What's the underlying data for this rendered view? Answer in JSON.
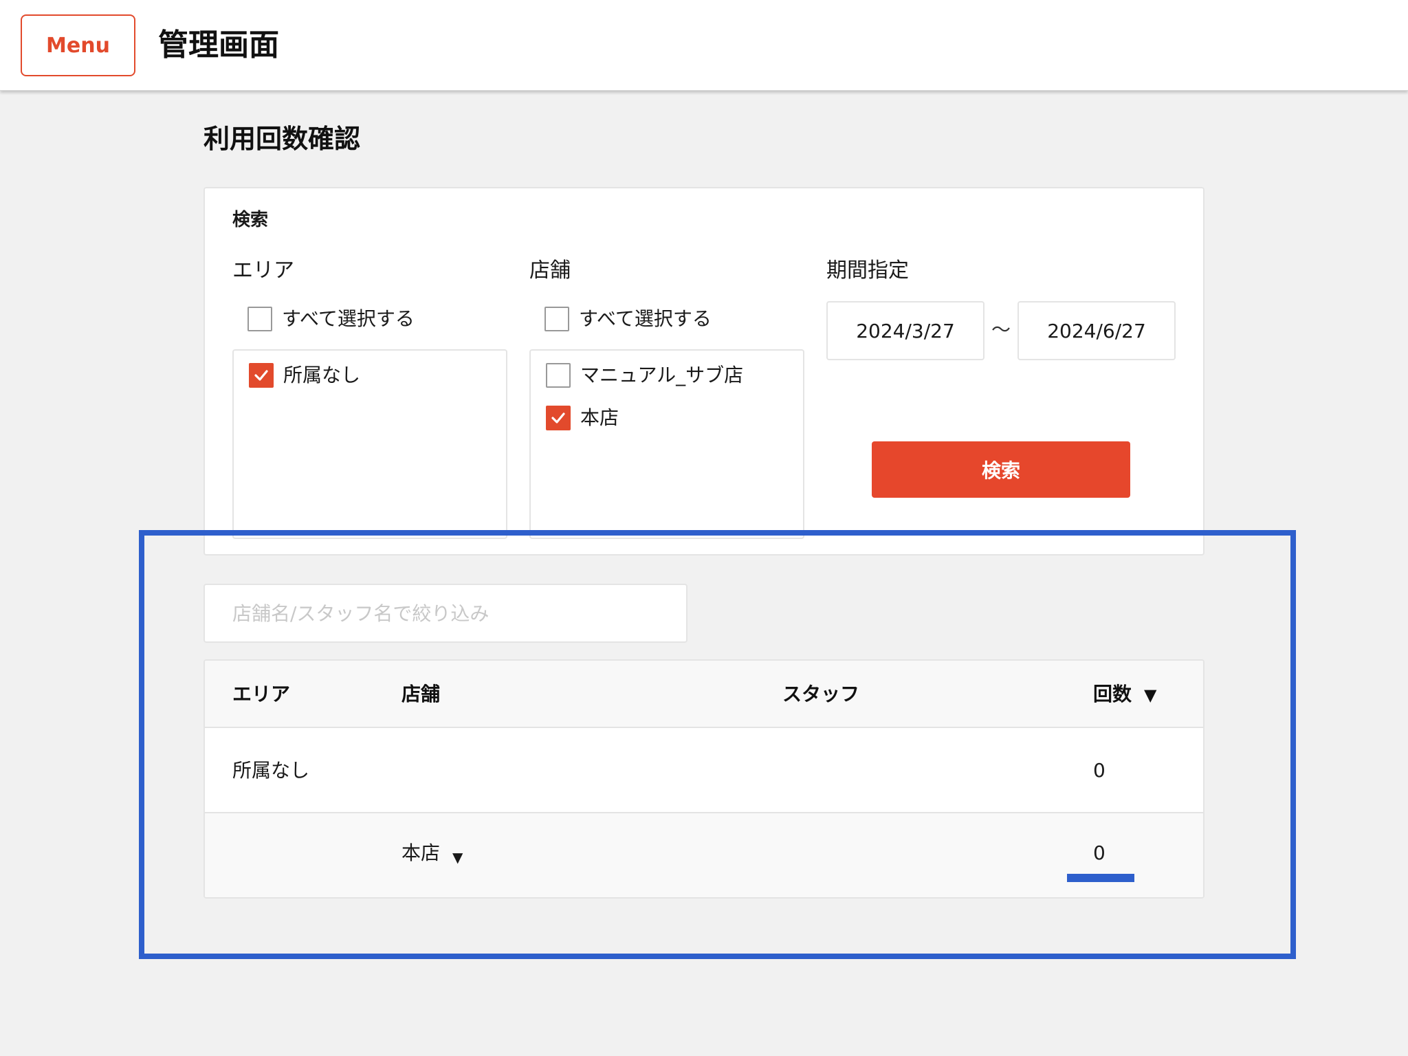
{
  "header": {
    "menu_label": "Menu",
    "app_title": "管理画面"
  },
  "page": {
    "title": "利用回数確認"
  },
  "search": {
    "heading": "検索",
    "area": {
      "label": "エリア",
      "select_all": {
        "label": "すべて選択する",
        "checked": false
      },
      "options": [
        {
          "label": "所属なし",
          "checked": true
        }
      ]
    },
    "store": {
      "label": "店舗",
      "select_all": {
        "label": "すべて選択する",
        "checked": false
      },
      "options": [
        {
          "label": "マニュアル_サブ店",
          "checked": false
        },
        {
          "label": "本店",
          "checked": true
        }
      ]
    },
    "period": {
      "label": "期間指定",
      "from": "2024/3/27",
      "separator": "〜",
      "to": "2024/6/27"
    },
    "button_label": "検索"
  },
  "filter": {
    "placeholder": "店舗名/スタッフ名で絞り込み"
  },
  "table": {
    "columns": [
      "エリア",
      "店舗",
      "スタッフ",
      "回数"
    ],
    "sort_indicator": "▼",
    "rows": [
      {
        "area": "所属なし",
        "store": "",
        "staff": "",
        "count": "0"
      },
      {
        "area": "",
        "store": "本店",
        "store_toggle": "▼",
        "staff": "",
        "count": "0"
      }
    ]
  },
  "colors": {
    "accent": "#e6472c",
    "highlight": "#2e5fcc",
    "background": "#f1f1f1"
  }
}
